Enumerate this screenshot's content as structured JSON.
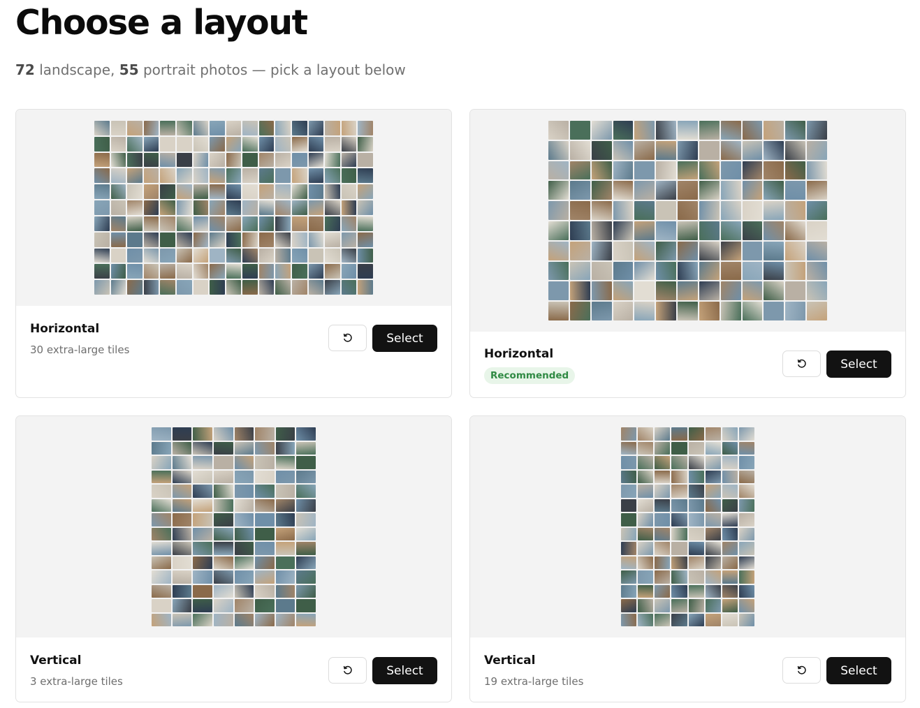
{
  "header": {
    "title": "Choose a layout",
    "subtitle": {
      "landscape_count": "72",
      "landscape_label": " landscape, ",
      "portrait_count": "55",
      "portrait_label": " portrait photos — pick a layout below"
    }
  },
  "cards": [
    {
      "title": "Horizontal",
      "description": "30 extra-large tiles",
      "badge": "",
      "select_label": "Select",
      "mosaic_cols": 17,
      "mosaic_rows": 11
    },
    {
      "title": "Horizontal",
      "description": "",
      "badge": "Recommended",
      "select_label": "Select",
      "mosaic_cols": 13,
      "mosaic_rows": 10
    },
    {
      "title": "Vertical",
      "description": "3 extra-large tiles",
      "badge": "",
      "select_label": "Select",
      "mosaic_cols": 8,
      "mosaic_rows": 14
    },
    {
      "title": "Vertical",
      "description": "19 extra-large tiles",
      "badge": "",
      "select_label": "Select",
      "mosaic_cols": 8,
      "mosaic_rows": 14
    }
  ],
  "icons": {
    "reset": "rotate-ccw-icon"
  },
  "colors": {
    "accent": "#121212",
    "badge_text": "#2f8a43",
    "badge_bg": "#e8f5e9",
    "preview_bg": "#f3f3f3"
  }
}
